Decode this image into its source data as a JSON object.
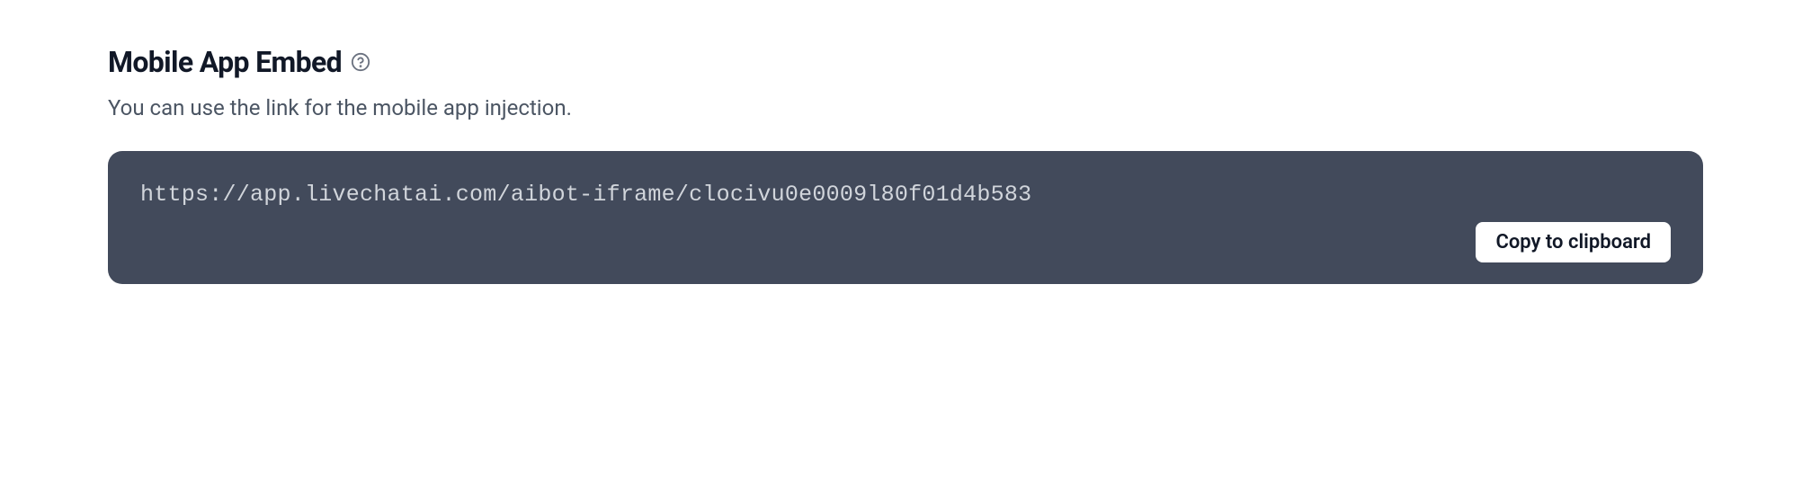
{
  "section": {
    "title": "Mobile App Embed",
    "description": "You can use the link for the mobile app injection."
  },
  "embed": {
    "url": "https://app.livechatai.com/aibot-iframe/clocivu0e0009l80f01d4b583",
    "copy_button_label": "Copy to clipboard"
  }
}
